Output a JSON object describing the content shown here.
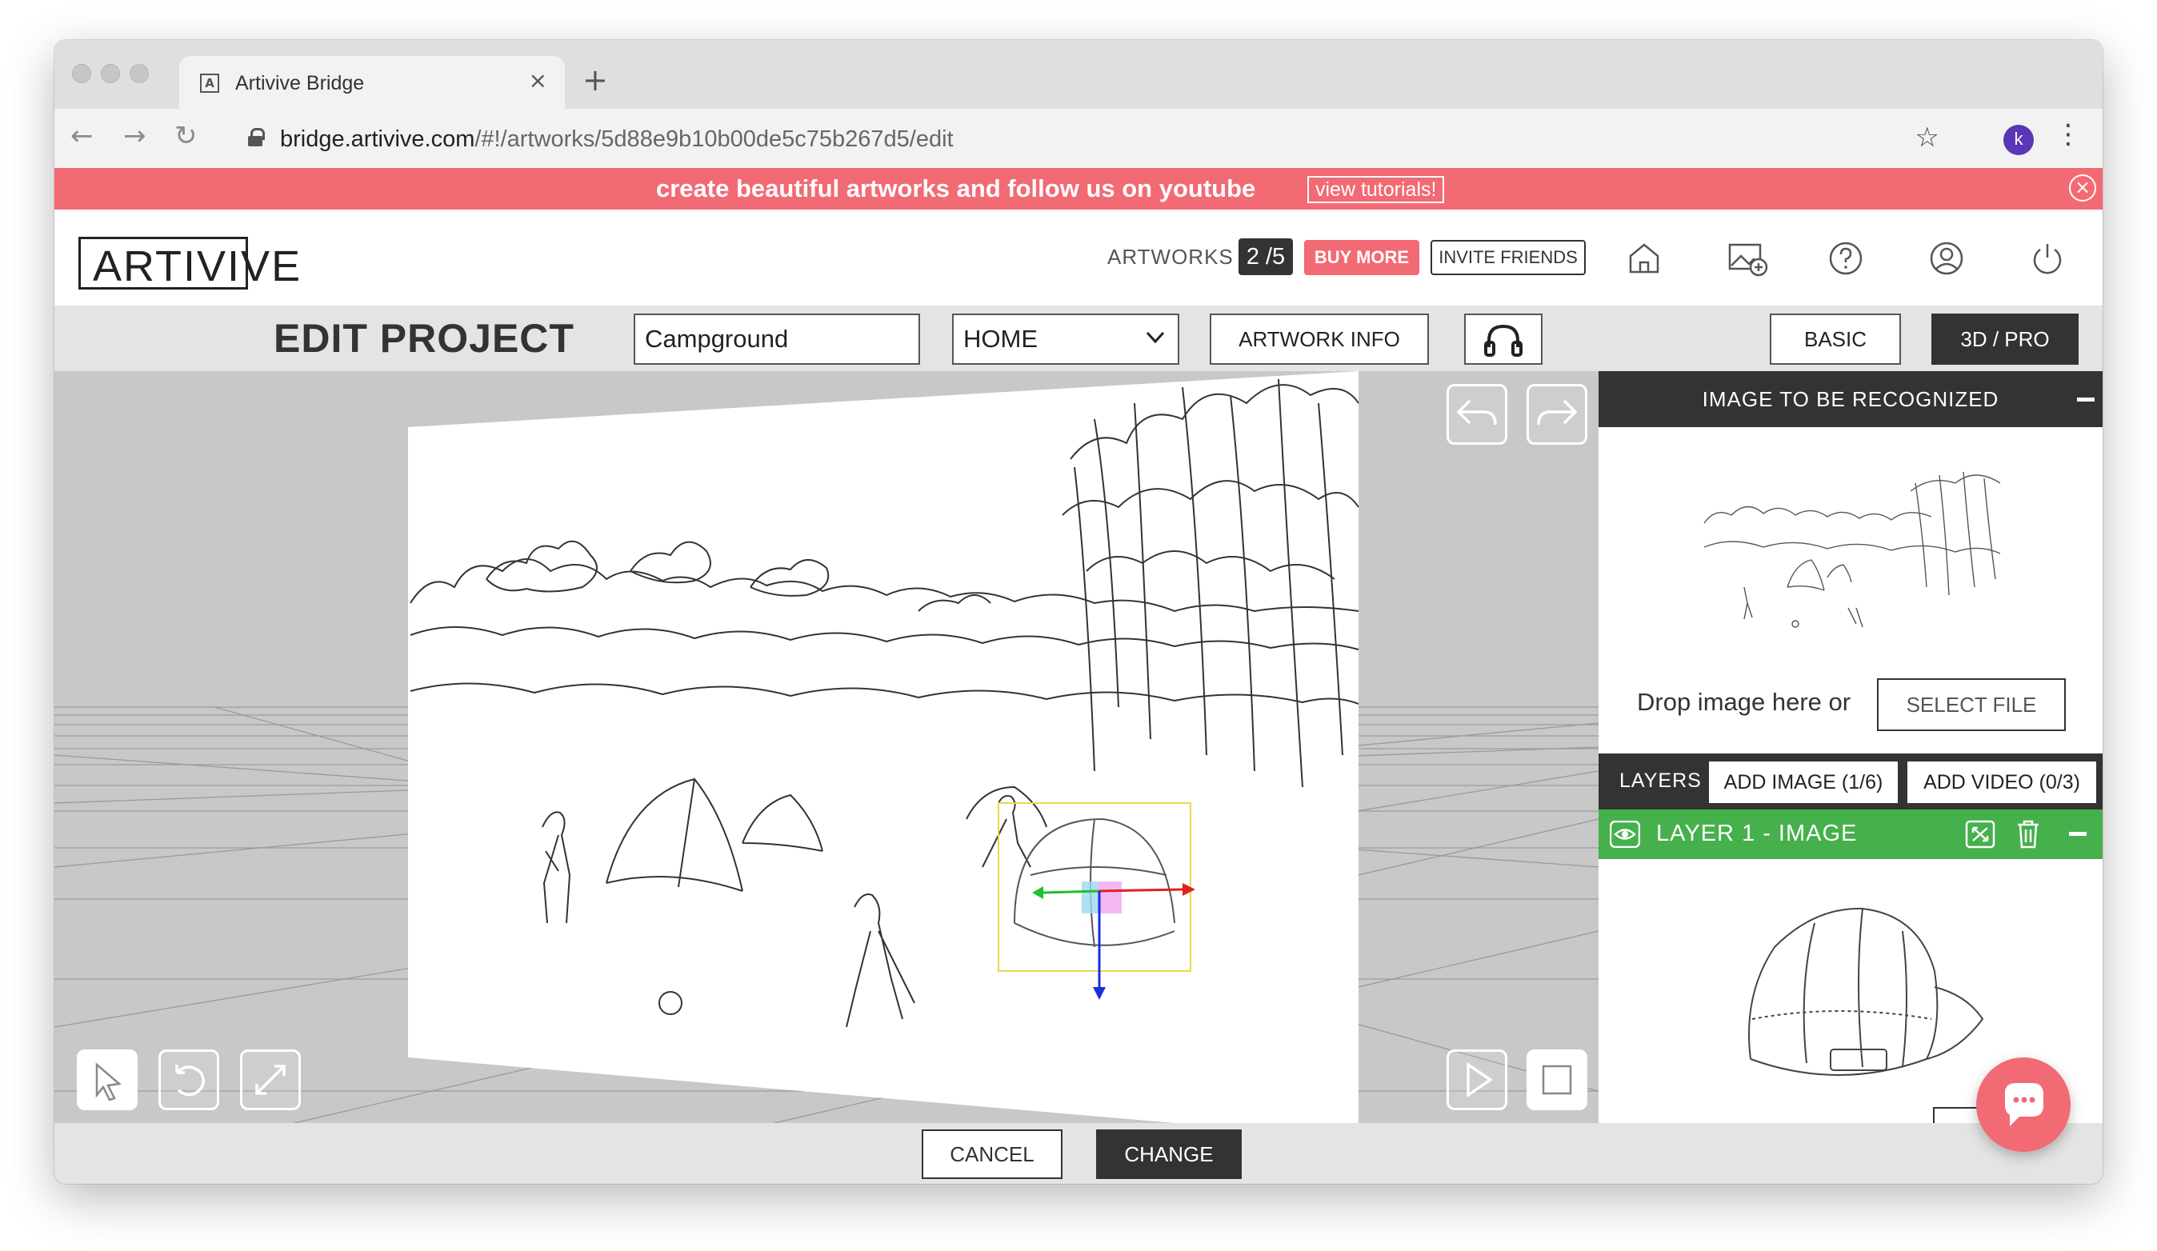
{
  "browser": {
    "tab_title": "Artivive Bridge",
    "tab_favicon": "A",
    "url_domain": "bridge.artivive.com",
    "url_path": "/#!/artworks/5d88e9b10b00de5c75b267d5/edit",
    "profile_initial": "k",
    "icons": [
      "back-arrow-icon",
      "forward-arrow-icon",
      "reload-icon",
      "lock-icon",
      "bookmark-star-icon",
      "kebab-menu-icon",
      "close-icon",
      "plus-icon"
    ]
  },
  "banner": {
    "text": "create beautiful artworks and follow us on youtube",
    "button": "view tutorials!",
    "color": "#f26a74"
  },
  "header": {
    "logo": "ARTIVIVE",
    "artworks_label": "ARTWORKS",
    "artworks_count": "2 /5",
    "buy_more": "BUY MORE",
    "invite_friends": "INVITE FRIENDS",
    "icons": [
      "home-icon",
      "gallery-add-icon",
      "help-icon",
      "account-icon",
      "power-icon"
    ]
  },
  "toolbar": {
    "title": "EDIT PROJECT",
    "project_name": "Campground",
    "category": "HOME",
    "artwork_info": "ARTWORK INFO",
    "mode_basic": "BASIC",
    "mode_pro": "3D / PRO",
    "active_mode": "3D / PRO"
  },
  "viewport": {
    "icons": [
      "undo-icon",
      "redo-icon",
      "select-cursor-icon",
      "rotate-icon",
      "scale-icon",
      "play-icon",
      "stop-icon"
    ]
  },
  "right_panel": {
    "recognized_title": "IMAGE TO BE RECOGNIZED",
    "drop_text": "Drop image here or",
    "select_file": "SELECT FILE",
    "layers_label": "LAYERS",
    "add_image": "ADD IMAGE (1/6)",
    "add_video": "ADD VIDEO (0/3)",
    "layer_title": "LAYER 1 - IMAGE",
    "layer_color": "#45b04c"
  },
  "bottom": {
    "cancel": "CANCEL",
    "change": "CHANGE"
  }
}
